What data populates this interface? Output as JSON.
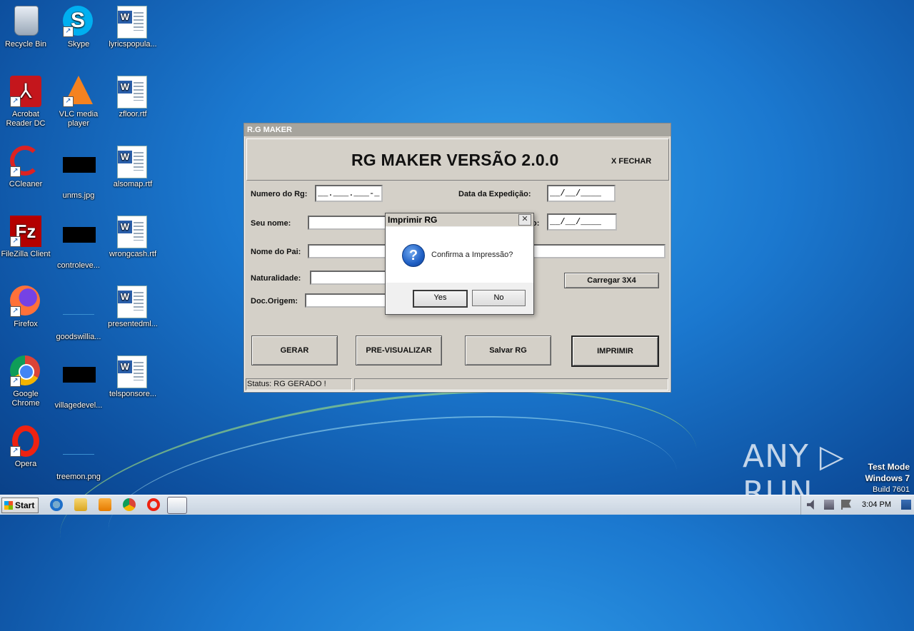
{
  "desktop": {
    "icons": [
      {
        "label": "Recycle Bin"
      },
      {
        "label": "Skype"
      },
      {
        "label": "lyricspopula..."
      },
      {
        "label": "Acrobat Reader DC"
      },
      {
        "label": "VLC media player"
      },
      {
        "label": "zfloor.rtf"
      },
      {
        "label": "CCleaner"
      },
      {
        "label": "unms.jpg"
      },
      {
        "label": "alsomap.rtf"
      },
      {
        "label": "FileZilla Client"
      },
      {
        "label": "controleve..."
      },
      {
        "label": "wrongcash.rtf"
      },
      {
        "label": "Firefox"
      },
      {
        "label": "goodswillia..."
      },
      {
        "label": "presentedml..."
      },
      {
        "label": "Google Chrome"
      },
      {
        "label": "villagedevel..."
      },
      {
        "label": "telsponsore..."
      },
      {
        "label": "Opera"
      },
      {
        "label": "treemon.png"
      }
    ],
    "skype_glyph": "S",
    "acrobat_glyph": "⅄",
    "filezilla_glyph": "Fz"
  },
  "app": {
    "window_title": "R.G MAKER",
    "title": "RG MAKER VERSÃO 2.0.0",
    "close_label": "X FECHAR",
    "fields": {
      "numero_rg_label": "Numero do Rg:",
      "numero_rg_value": "__.___.___-_",
      "data_expedicao_label": "Data da Expedição:",
      "data_expedicao_value": "__/__/____",
      "seu_nome_label": "Seu nome:",
      "seu_nome_value": "",
      "nascimento_label_visible": "o:",
      "nascimento_value": "__/__/____",
      "nome_pai_label": "Nome do Pai:",
      "nome_pai_value": "",
      "naturalidade_label": "Naturalidade:",
      "naturalidade_value": "",
      "doc_origem_label": "Doc.Origem:",
      "doc_origem_value": ""
    },
    "carregar_label": "Carregar  3X4",
    "buttons": {
      "gerar": "GERAR",
      "previsualizar": "PRE-VISUALIZAR",
      "salvar": "Salvar RG",
      "imprimir": "IMPRIMIR"
    },
    "status": "Status: RG GERADO !"
  },
  "dialog": {
    "title": "Imprimir RG",
    "close_glyph": "✕",
    "icon_glyph": "?",
    "message": "Confirma a Impressão?",
    "yes": "Yes",
    "no": "No"
  },
  "taskbar": {
    "start_label": "Start",
    "time": "3:04 PM"
  },
  "watermark": "ANY ▷ RUN",
  "testmode": {
    "line1": "Test Mode",
    "line2": "Windows 7",
    "line3": "Build 7601"
  }
}
